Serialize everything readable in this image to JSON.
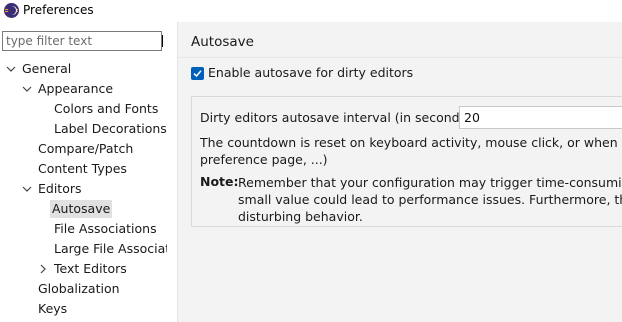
{
  "window": {
    "title": "Preferences"
  },
  "filter": {
    "placeholder": "type filter text"
  },
  "tree": {
    "general": "General",
    "appearance": "Appearance",
    "colors_and_fonts": "Colors and Fonts",
    "label_decorations": "Label Decorations",
    "compare_patch": "Compare/Patch",
    "content_types": "Content Types",
    "editors": "Editors",
    "autosave": "Autosave",
    "file_associations": "File Associations",
    "large_file_associations": "Large File Associations",
    "text_editors": "Text Editors",
    "globalization": "Globalization",
    "keys": "Keys"
  },
  "page": {
    "title": "Autosave",
    "enable_label": "Enable autosave for dirty editors",
    "enabled": true,
    "interval_label": "Dirty editors autosave interval (in seconds):",
    "interval_value": "20",
    "description_line1": "The countdown is reset on keyboard activity, mouse click, or when a popup is displayed (e.g. content assist,",
    "description_line2": "preference page, ...)",
    "note_label": "Note:",
    "note_line1": "Remember that your configuration may trigger time-consuming actions on save, so setting a",
    "note_line2": "small value could lead to performance issues. Furthermore, the Save action might cause",
    "note_line3": "disturbing behavior."
  },
  "colors": {
    "accent": "#005fb8",
    "selection": "#e1e1e1",
    "panel": "#f3f3f3"
  }
}
